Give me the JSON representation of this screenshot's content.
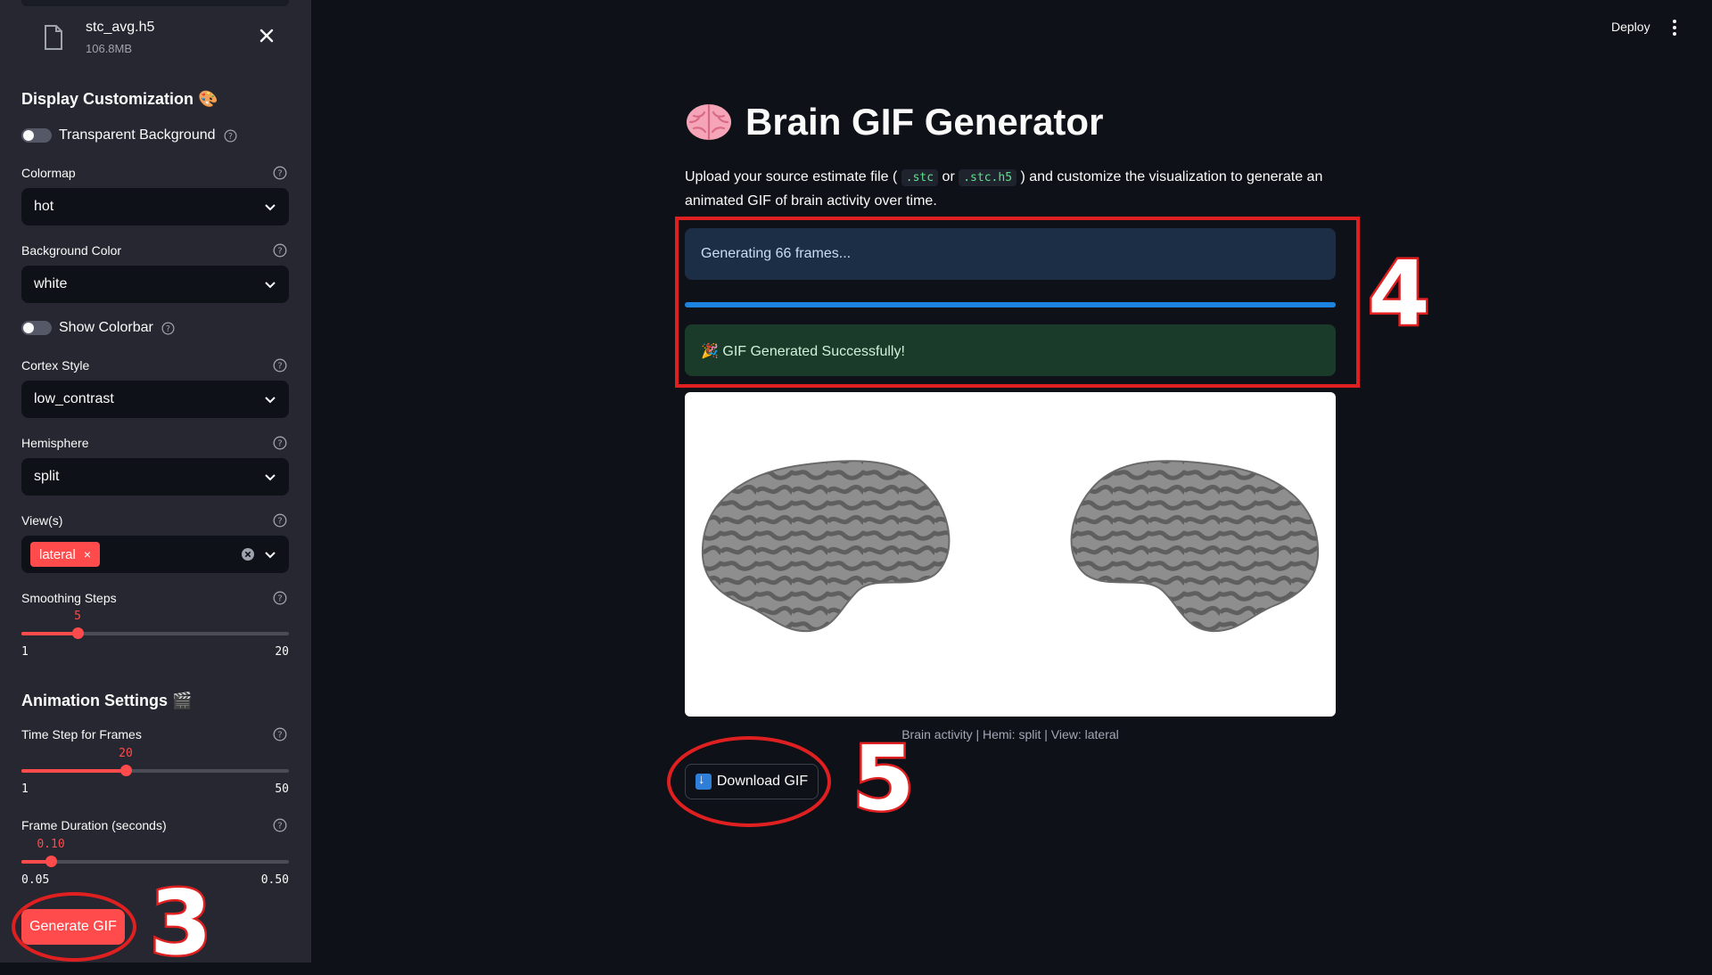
{
  "sidebar": {
    "file": {
      "name": "stc_avg.h5",
      "size": "106.8MB"
    },
    "display_title": "Display Customization 🎨",
    "transparent_bg_label": "Transparent Background",
    "colormap": {
      "label": "Colormap",
      "value": "hot"
    },
    "background_color": {
      "label": "Background Color",
      "value": "white"
    },
    "show_colorbar_label": "Show Colorbar",
    "cortex_style": {
      "label": "Cortex Style",
      "value": "low_contrast"
    },
    "hemisphere": {
      "label": "Hemisphere",
      "value": "split"
    },
    "views": {
      "label": "View(s)",
      "tag": "lateral",
      "tag_remove": "×"
    },
    "smoothing": {
      "label": "Smoothing Steps",
      "value": "5",
      "min": "1",
      "max": "20",
      "level": 0.21
    },
    "animation_title": "Animation Settings 🎬",
    "time_step": {
      "label": "Time Step for Frames",
      "value": "20",
      "min": "1",
      "max": "50",
      "level": 0.39
    },
    "frame_duration": {
      "label": "Frame Duration (seconds)",
      "value": "0.10",
      "min": "0.05",
      "max": "0.50",
      "level": 0.11
    },
    "generate_button": "Generate GIF"
  },
  "header": {
    "deploy_label": "Deploy"
  },
  "main": {
    "title": "Brain GIF Generator",
    "desc_before": "Upload your source estimate file (",
    "desc_code1": ".stc",
    "desc_or": "or",
    "desc_code2": ".stc.h5",
    "desc_after": ") and customize the visualization to generate an animated GIF of brain activity over time.",
    "info_text": "Generating 66 frames...",
    "progress_fraction": 1.0,
    "success_text": "🎉 GIF Generated Successfully!",
    "caption": "Brain activity | Hemi: split | View: lateral",
    "download_label": "Download GIF"
  },
  "annotations": {
    "step3": "3",
    "step4": "4",
    "step5": "5"
  },
  "colors": {
    "accent": "#ff4b4b",
    "info_bg": "#1c2e46",
    "success_bg": "#1a3b2a",
    "annotation": "#e02020"
  }
}
